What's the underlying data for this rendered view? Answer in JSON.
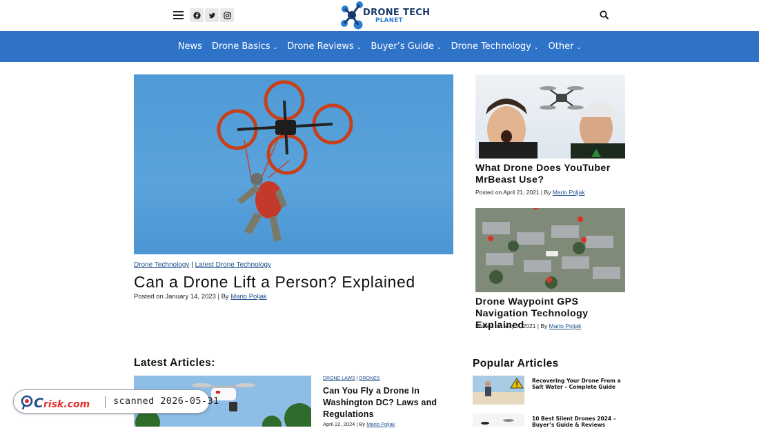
{
  "header": {
    "logo_text": "DRONE TECH",
    "logo_sub": "PLANET",
    "menu_icon": "hamburger-icon",
    "social": [
      {
        "name": "facebook-icon",
        "glyph": "f"
      },
      {
        "name": "twitter-icon",
        "glyph": "t"
      },
      {
        "name": "instagram-icon",
        "glyph": "◎"
      }
    ],
    "search_icon": "search-icon"
  },
  "nav": {
    "items": [
      {
        "label": "News",
        "has_dropdown": false
      },
      {
        "label": "Drone Basics",
        "has_dropdown": true
      },
      {
        "label": "Drone Reviews",
        "has_dropdown": true
      },
      {
        "label": "Buyer’s Guide",
        "has_dropdown": true
      },
      {
        "label": "Drone Technology",
        "has_dropdown": true
      },
      {
        "label": "Other",
        "has_dropdown": true
      }
    ],
    "chevron": "⌄"
  },
  "hero": {
    "category_1": "Drone Technology",
    "separator": " | ",
    "category_2": "Latest Drone Technology",
    "title": "Can a Drone Lift a Person? Explained",
    "posted_prefix": "Posted on ",
    "date": "January 14, 2023",
    "by_prefix": " | By ",
    "author": "Mario Poljak"
  },
  "side_articles": [
    {
      "title": "What Drone Does YouTuber MrBeast Use?",
      "posted_prefix": "Posted on ",
      "date": "April 21, 2021",
      "by_prefix": " | By ",
      "author": "Mario Poljak"
    },
    {
      "title": "Drone Waypoint GPS Navigation Technology Explained",
      "posted_prefix": "Posted on ",
      "date": "May 7, 2021",
      "by_prefix": " | By ",
      "author": "Mario Poljak"
    }
  ],
  "latest": {
    "heading": "Latest Articles:",
    "article": {
      "category_1": "DRONE LAWS",
      "separator": " | ",
      "category_2": "DRONES",
      "title": "Can You Fly a Drone In Washington DC? Laws and Regulations",
      "date": "April 22, 2024",
      "by_prefix": " | By ",
      "author": "Mario Poljak"
    }
  },
  "popular": {
    "heading": "Popular Articles",
    "items": [
      {
        "title": "Recovering Your Drone From a Salt Water – Complete Guide"
      },
      {
        "title": "10 Best Silent Drones 2024 – Buyer’s Guide & Reviews"
      }
    ]
  },
  "watermark": {
    "brand": "PCrisk.com",
    "text": "scanned 2026-05-31"
  },
  "colors": {
    "nav_bg": "#2f73c9",
    "link": "#1b4d8c",
    "logo_dark": "#1a3a6b",
    "logo_blue": "#2a7fd0"
  }
}
